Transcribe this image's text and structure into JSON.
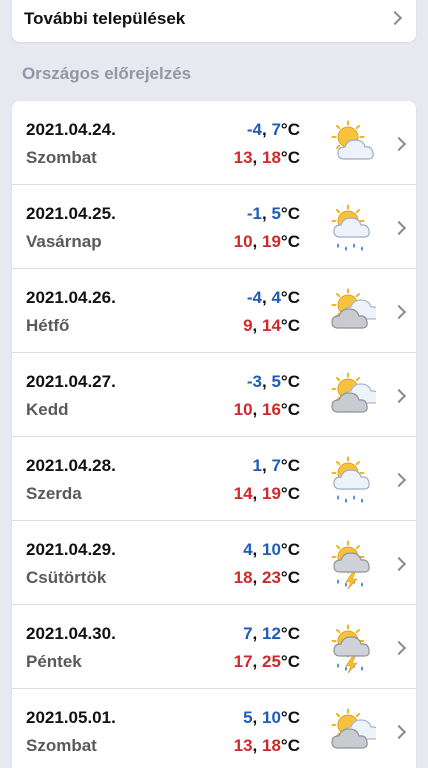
{
  "top_link": {
    "label": "További települések"
  },
  "section": {
    "title": "Országos előrejelzés"
  },
  "days": [
    {
      "date": "2021.04.24.",
      "day": "Szombat",
      "min_low": "-4",
      "min_high": "7",
      "max_low": "13",
      "max_high": "18",
      "unit": "°C",
      "icon": "sun-cloud-icon"
    },
    {
      "date": "2021.04.25.",
      "day": "Vasárnap",
      "min_low": "-1",
      "min_high": "5",
      "max_low": "10",
      "max_high": "19",
      "unit": "°C",
      "icon": "sun-rain-icon"
    },
    {
      "date": "2021.04.26.",
      "day": "Hétfő",
      "min_low": "-4",
      "min_high": "4",
      "max_low": "9",
      "max_high": "14",
      "unit": "°C",
      "icon": "sun-clouds-icon"
    },
    {
      "date": "2021.04.27.",
      "day": "Kedd",
      "min_low": "-3",
      "min_high": "5",
      "max_low": "10",
      "max_high": "16",
      "unit": "°C",
      "icon": "sun-clouds-icon"
    },
    {
      "date": "2021.04.28.",
      "day": "Szerda",
      "min_low": "1",
      "min_high": "7",
      "max_low": "14",
      "max_high": "19",
      "unit": "°C",
      "icon": "sun-rain-icon"
    },
    {
      "date": "2021.04.29.",
      "day": "Csütörtök",
      "min_low": "4",
      "min_high": "10",
      "max_low": "18",
      "max_high": "23",
      "unit": "°C",
      "icon": "thunderstorm-icon"
    },
    {
      "date": "2021.04.30.",
      "day": "Péntek",
      "min_low": "7",
      "min_high": "12",
      "max_low": "17",
      "max_high": "25",
      "unit": "°C",
      "icon": "thunderstorm-icon"
    },
    {
      "date": "2021.05.01.",
      "day": "Szombat",
      "min_low": "5",
      "min_high": "10",
      "max_low": "13",
      "max_high": "18",
      "unit": "°C",
      "icon": "sun-clouds-icon"
    }
  ],
  "colors": {
    "min_temp": "#1f5db5",
    "max_temp": "#cf2a2a",
    "background": "#e8e9f0"
  }
}
